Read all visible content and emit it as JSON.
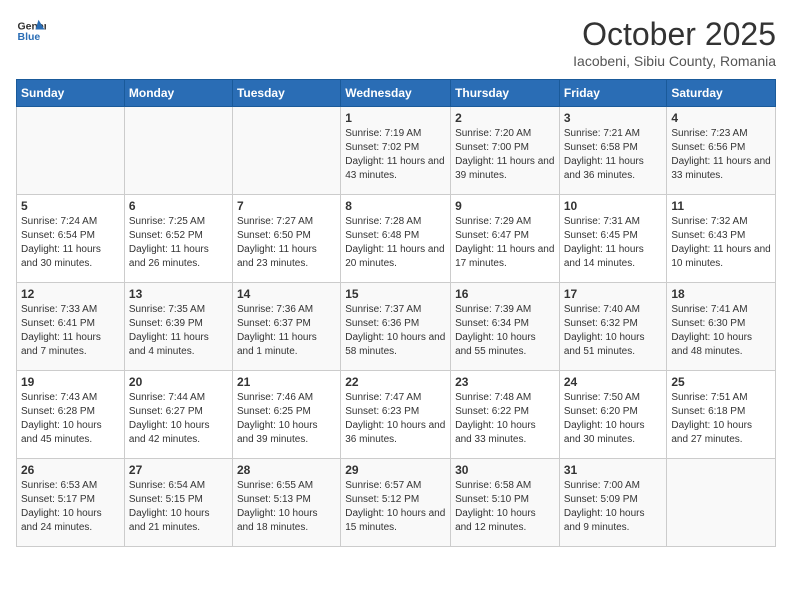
{
  "header": {
    "logo_line1": "General",
    "logo_line2": "Blue",
    "month": "October 2025",
    "location": "Iacobeni, Sibiu County, Romania"
  },
  "weekdays": [
    "Sunday",
    "Monday",
    "Tuesday",
    "Wednesday",
    "Thursday",
    "Friday",
    "Saturday"
  ],
  "weeks": [
    [
      {
        "day": "",
        "info": ""
      },
      {
        "day": "",
        "info": ""
      },
      {
        "day": "",
        "info": ""
      },
      {
        "day": "1",
        "info": "Sunrise: 7:19 AM\nSunset: 7:02 PM\nDaylight: 11 hours and 43 minutes."
      },
      {
        "day": "2",
        "info": "Sunrise: 7:20 AM\nSunset: 7:00 PM\nDaylight: 11 hours and 39 minutes."
      },
      {
        "day": "3",
        "info": "Sunrise: 7:21 AM\nSunset: 6:58 PM\nDaylight: 11 hours and 36 minutes."
      },
      {
        "day": "4",
        "info": "Sunrise: 7:23 AM\nSunset: 6:56 PM\nDaylight: 11 hours and 33 minutes."
      }
    ],
    [
      {
        "day": "5",
        "info": "Sunrise: 7:24 AM\nSunset: 6:54 PM\nDaylight: 11 hours and 30 minutes."
      },
      {
        "day": "6",
        "info": "Sunrise: 7:25 AM\nSunset: 6:52 PM\nDaylight: 11 hours and 26 minutes."
      },
      {
        "day": "7",
        "info": "Sunrise: 7:27 AM\nSunset: 6:50 PM\nDaylight: 11 hours and 23 minutes."
      },
      {
        "day": "8",
        "info": "Sunrise: 7:28 AM\nSunset: 6:48 PM\nDaylight: 11 hours and 20 minutes."
      },
      {
        "day": "9",
        "info": "Sunrise: 7:29 AM\nSunset: 6:47 PM\nDaylight: 11 hours and 17 minutes."
      },
      {
        "day": "10",
        "info": "Sunrise: 7:31 AM\nSunset: 6:45 PM\nDaylight: 11 hours and 14 minutes."
      },
      {
        "day": "11",
        "info": "Sunrise: 7:32 AM\nSunset: 6:43 PM\nDaylight: 11 hours and 10 minutes."
      }
    ],
    [
      {
        "day": "12",
        "info": "Sunrise: 7:33 AM\nSunset: 6:41 PM\nDaylight: 11 hours and 7 minutes."
      },
      {
        "day": "13",
        "info": "Sunrise: 7:35 AM\nSunset: 6:39 PM\nDaylight: 11 hours and 4 minutes."
      },
      {
        "day": "14",
        "info": "Sunrise: 7:36 AM\nSunset: 6:37 PM\nDaylight: 11 hours and 1 minute."
      },
      {
        "day": "15",
        "info": "Sunrise: 7:37 AM\nSunset: 6:36 PM\nDaylight: 10 hours and 58 minutes."
      },
      {
        "day": "16",
        "info": "Sunrise: 7:39 AM\nSunset: 6:34 PM\nDaylight: 10 hours and 55 minutes."
      },
      {
        "day": "17",
        "info": "Sunrise: 7:40 AM\nSunset: 6:32 PM\nDaylight: 10 hours and 51 minutes."
      },
      {
        "day": "18",
        "info": "Sunrise: 7:41 AM\nSunset: 6:30 PM\nDaylight: 10 hours and 48 minutes."
      }
    ],
    [
      {
        "day": "19",
        "info": "Sunrise: 7:43 AM\nSunset: 6:28 PM\nDaylight: 10 hours and 45 minutes."
      },
      {
        "day": "20",
        "info": "Sunrise: 7:44 AM\nSunset: 6:27 PM\nDaylight: 10 hours and 42 minutes."
      },
      {
        "day": "21",
        "info": "Sunrise: 7:46 AM\nSunset: 6:25 PM\nDaylight: 10 hours and 39 minutes."
      },
      {
        "day": "22",
        "info": "Sunrise: 7:47 AM\nSunset: 6:23 PM\nDaylight: 10 hours and 36 minutes."
      },
      {
        "day": "23",
        "info": "Sunrise: 7:48 AM\nSunset: 6:22 PM\nDaylight: 10 hours and 33 minutes."
      },
      {
        "day": "24",
        "info": "Sunrise: 7:50 AM\nSunset: 6:20 PM\nDaylight: 10 hours and 30 minutes."
      },
      {
        "day": "25",
        "info": "Sunrise: 7:51 AM\nSunset: 6:18 PM\nDaylight: 10 hours and 27 minutes."
      }
    ],
    [
      {
        "day": "26",
        "info": "Sunrise: 6:53 AM\nSunset: 5:17 PM\nDaylight: 10 hours and 24 minutes."
      },
      {
        "day": "27",
        "info": "Sunrise: 6:54 AM\nSunset: 5:15 PM\nDaylight: 10 hours and 21 minutes."
      },
      {
        "day": "28",
        "info": "Sunrise: 6:55 AM\nSunset: 5:13 PM\nDaylight: 10 hours and 18 minutes."
      },
      {
        "day": "29",
        "info": "Sunrise: 6:57 AM\nSunset: 5:12 PM\nDaylight: 10 hours and 15 minutes."
      },
      {
        "day": "30",
        "info": "Sunrise: 6:58 AM\nSunset: 5:10 PM\nDaylight: 10 hours and 12 minutes."
      },
      {
        "day": "31",
        "info": "Sunrise: 7:00 AM\nSunset: 5:09 PM\nDaylight: 10 hours and 9 minutes."
      },
      {
        "day": "",
        "info": ""
      }
    ]
  ]
}
